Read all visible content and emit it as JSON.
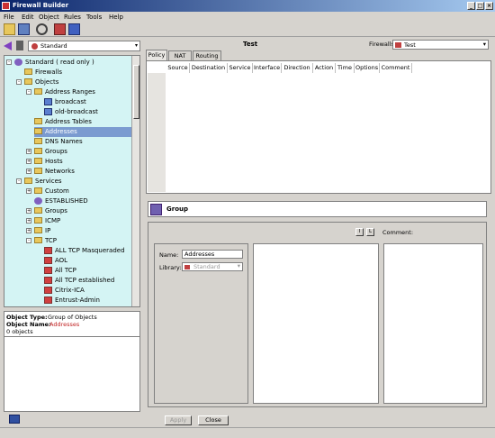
{
  "window": {
    "title": "Firewall Builder"
  },
  "menu": [
    "File",
    "Edit",
    "Object",
    "Rules",
    "Tools",
    "Help"
  ],
  "library_selector": {
    "value": "Standard"
  },
  "tree": [
    {
      "label": "Standard ( read only )",
      "level": 0,
      "expand": "-",
      "icon": "library"
    },
    {
      "label": "Firewalls",
      "level": 1,
      "icon": "folder"
    },
    {
      "label": "Objects",
      "level": 1,
      "expand": "-",
      "icon": "folder"
    },
    {
      "label": "Address Ranges",
      "level": 2,
      "expand": "-",
      "icon": "folder"
    },
    {
      "label": "broadcast",
      "level": 3,
      "icon": "net"
    },
    {
      "label": "old-broadcast",
      "level": 3,
      "icon": "net"
    },
    {
      "label": "Address Tables",
      "level": 2,
      "icon": "folder"
    },
    {
      "label": "Addresses",
      "level": 2,
      "icon": "folder",
      "selected": true
    },
    {
      "label": "DNS Names",
      "level": 2,
      "icon": "folder"
    },
    {
      "label": "Groups",
      "level": 2,
      "expand": "+",
      "icon": "folder"
    },
    {
      "label": "Hosts",
      "level": 2,
      "expand": "+",
      "icon": "folder"
    },
    {
      "label": "Networks",
      "level": 2,
      "expand": "+",
      "icon": "folder"
    },
    {
      "label": "Services",
      "level": 1,
      "expand": "-",
      "icon": "folder"
    },
    {
      "label": "Custom",
      "level": 2,
      "expand": "+",
      "icon": "folder"
    },
    {
      "label": "ESTABLISHED",
      "level": 2,
      "icon": "est"
    },
    {
      "label": "Groups",
      "level": 2,
      "expand": "+",
      "icon": "folder"
    },
    {
      "label": "ICMP",
      "level": 2,
      "expand": "+",
      "icon": "folder"
    },
    {
      "label": "IP",
      "level": 2,
      "expand": "+",
      "icon": "folder"
    },
    {
      "label": "TCP",
      "level": 2,
      "expand": "-",
      "icon": "folder"
    },
    {
      "label": "ALL TCP Masqueraded",
      "level": 3,
      "icon": "svc"
    },
    {
      "label": "AOL",
      "level": 3,
      "icon": "svc"
    },
    {
      "label": "All TCP",
      "level": 3,
      "icon": "svc"
    },
    {
      "label": "All TCP established",
      "level": 3,
      "icon": "svc"
    },
    {
      "label": "Citrix-ICA",
      "level": 3,
      "icon": "svc"
    },
    {
      "label": "Entrust-Admin",
      "level": 3,
      "icon": "svc"
    }
  ],
  "info": {
    "type_label": "Object Type:",
    "type_value": "Group of Objects",
    "name_label": "Object Name:",
    "name_value": "Addresses",
    "count": "0 objects"
  },
  "firewall": {
    "title": "Test",
    "label": "Firewalls",
    "selected": "Test"
  },
  "tabs": [
    "Policy",
    "NAT",
    "Routing"
  ],
  "policy_columns": [
    "Source",
    "Destination",
    "Service",
    "Interface",
    "Direction",
    "Action",
    "Time",
    "Options",
    "Comment"
  ],
  "group": {
    "header": "Group",
    "btn_i": "I",
    "btn_l": "L",
    "comment_label": "Comment:",
    "name_label": "Name:",
    "name_value": "Addresses",
    "library_label": "Library:",
    "library_value": "Standard"
  },
  "buttons": {
    "apply": "Apply",
    "close": "Close"
  }
}
